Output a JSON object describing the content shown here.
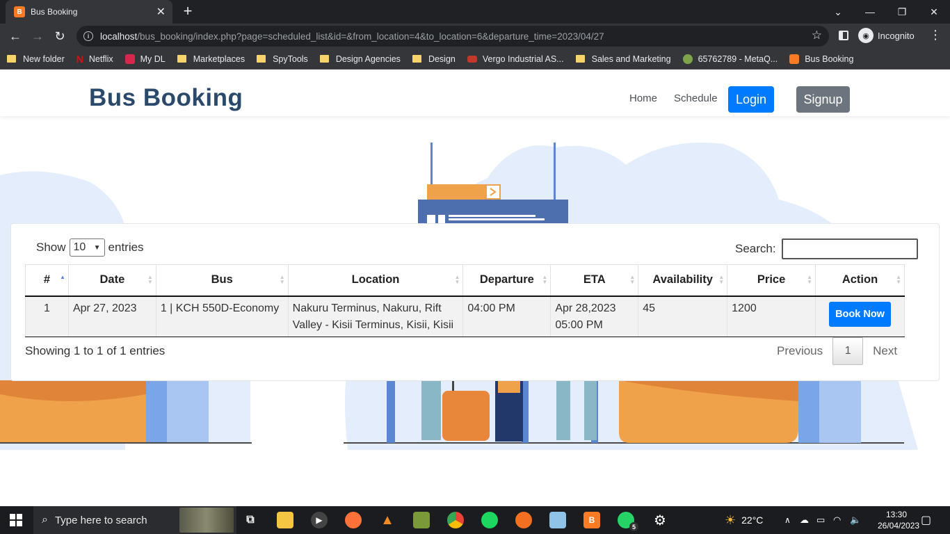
{
  "browser": {
    "tab_title": "Bus Booking",
    "tab_favicon": "B",
    "url_host": "localhost",
    "url_rest": "/bus_booking/index.php?page=scheduled_list&id=&from_location=4&to_location=6&departure_time=2023/04/27",
    "profile_label": "Incognito",
    "bookmarks": [
      {
        "label": "New folder",
        "icon": "folder-icon"
      },
      {
        "label": "Netflix",
        "icon": "netflix-icon"
      },
      {
        "label": "My DL",
        "icon": "mydl-icon"
      },
      {
        "label": "Marketplaces",
        "icon": "folder-icon"
      },
      {
        "label": "SpyTools",
        "icon": "folder-icon"
      },
      {
        "label": "Design Agencies",
        "icon": "folder-icon"
      },
      {
        "label": "Design",
        "icon": "folder-icon"
      },
      {
        "label": "Vergo Industrial AS...",
        "icon": "vergo-icon"
      },
      {
        "label": "Sales and Marketing",
        "icon": "folder-icon"
      },
      {
        "label": "65762789 - MetaQ...",
        "icon": "metaq-icon"
      },
      {
        "label": "Bus Booking",
        "icon": "bus-booking-icon"
      }
    ]
  },
  "site": {
    "brand": "Bus Booking",
    "nav": {
      "home": "Home",
      "schedule": "Schedule",
      "login": "Login",
      "signup": "Signup"
    },
    "colors": {
      "brand": "#2b4a6b",
      "primary": "#007bff",
      "secondary": "#6c757d"
    }
  },
  "table_ui": {
    "show_label": "Show",
    "entries_label": "entries",
    "page_length": "10",
    "search_label": "Search:",
    "search_value": "",
    "info": "Showing 1 to 1 of 1 entries",
    "prev": "Previous",
    "current_page": "1",
    "next": "Next"
  },
  "table": {
    "columns": [
      "#",
      "Date",
      "Bus",
      "Location",
      "Departure",
      "ETA",
      "Availability",
      "Price",
      "Action"
    ],
    "rows": [
      {
        "num": "1",
        "date": "Apr 27, 2023",
        "bus": "1 | KCH 550D-Economy",
        "location": "Nakuru Terminus, Nakuru, Rift Valley - Kisii Terminus, Kisii, Kisii",
        "departure": "04:00 PM",
        "eta": "Apr 28,2023 05:00 PM",
        "availability": "45",
        "price": "1200",
        "action": "Book Now"
      }
    ]
  },
  "taskbar": {
    "search_placeholder": "Type here to search",
    "weather": "22°C",
    "time": "13:30",
    "date": "26/04/2023",
    "whatsapp_badge": "5"
  }
}
